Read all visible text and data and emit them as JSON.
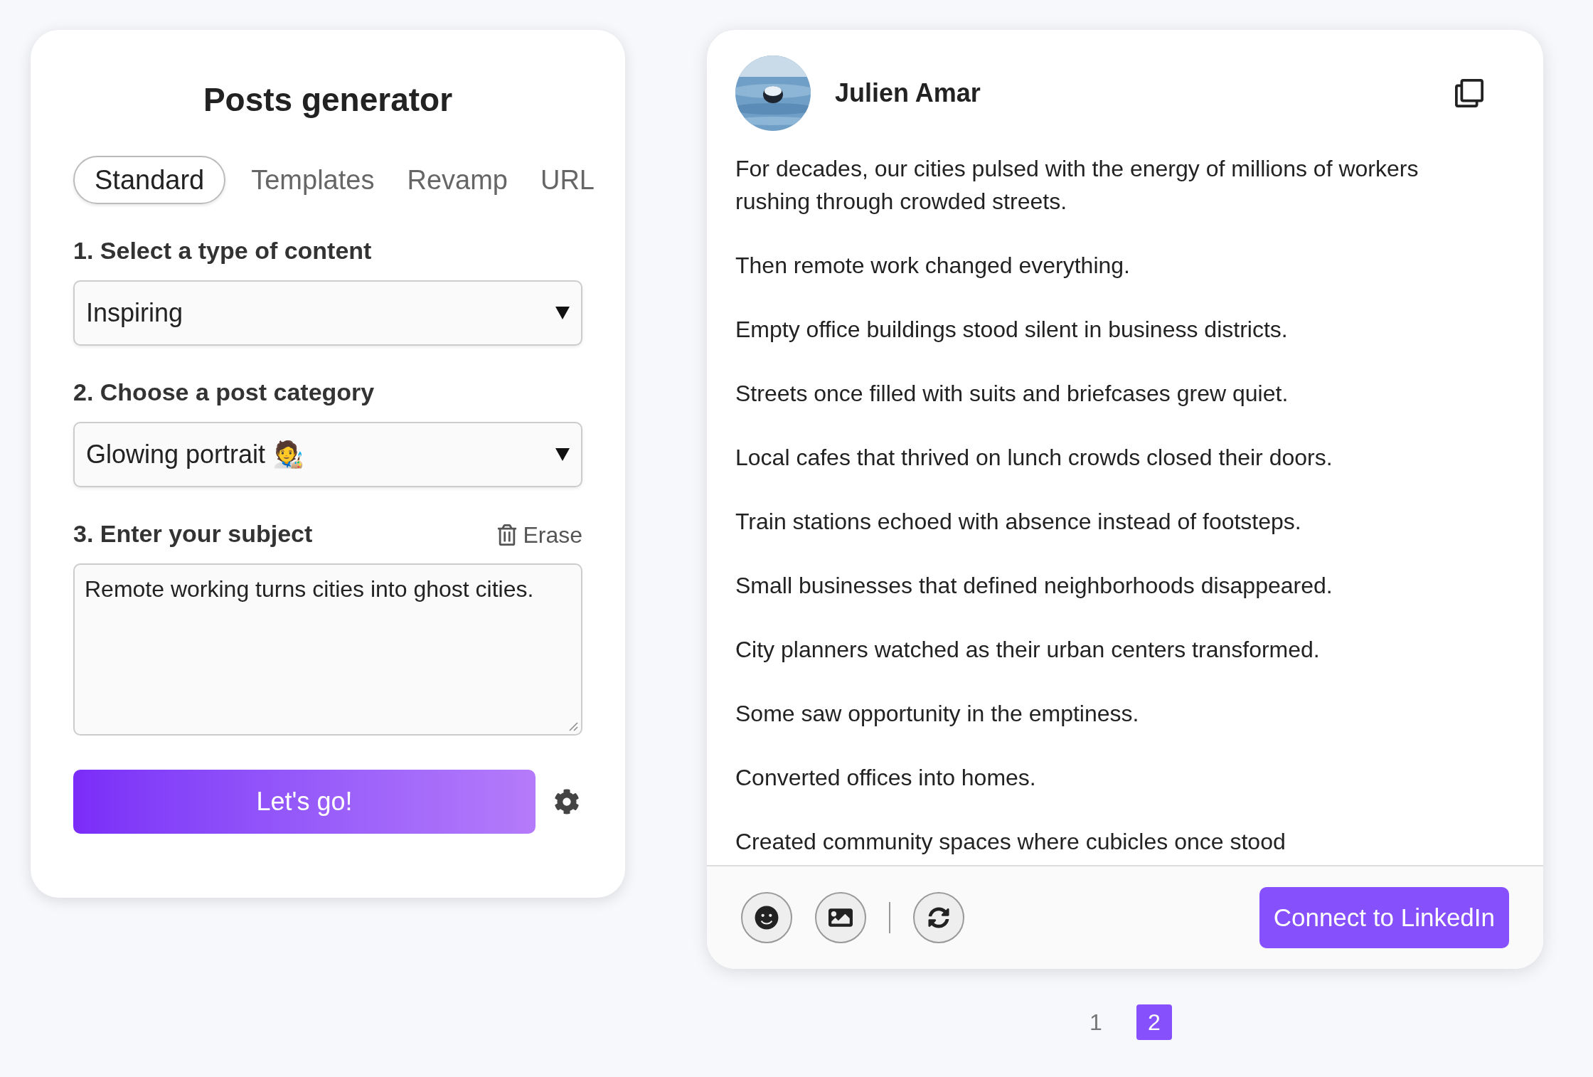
{
  "generator": {
    "title": "Posts generator",
    "tabs": [
      {
        "label": "Standard",
        "selected": true
      },
      {
        "label": "Templates",
        "selected": false
      },
      {
        "label": "Revamp",
        "selected": false
      },
      {
        "label": "URL",
        "selected": false
      }
    ],
    "steps": [
      {
        "kind": "select",
        "label": "1. Select a type of content",
        "value": "Inspiring"
      },
      {
        "kind": "select",
        "label": "2. Choose a post category",
        "value": "Glowing portrait 🧑‍🎨"
      },
      {
        "kind": "textarea",
        "label": "3. Enter your subject",
        "action": "Erase",
        "value": "Remote working turns cities into ghost cities."
      }
    ],
    "submit": "Let's go!"
  },
  "post": {
    "author": "Julien Amar",
    "paragraphs": [
      "For decades, our cities pulsed with the energy of millions of workers rushing through crowded streets.",
      "Then remote work changed everything.",
      "Empty office buildings stood silent in business districts.",
      "Streets once filled with suits and briefcases grew quiet.",
      "Local cafes that thrived on lunch crowds closed their doors.",
      "Train stations echoed with absence instead of footsteps.",
      "Small businesses that defined neighborhoods disappeared.",
      "City planners watched as their urban centers transformed.",
      "Some saw opportunity in the emptiness.",
      "Converted offices into homes.",
      "Created community spaces where cubicles once stood"
    ],
    "connect": "Connect to LinkedIn"
  },
  "pagination": [
    {
      "label": "1",
      "selected": false
    },
    {
      "label": "2",
      "selected": true
    }
  ]
}
